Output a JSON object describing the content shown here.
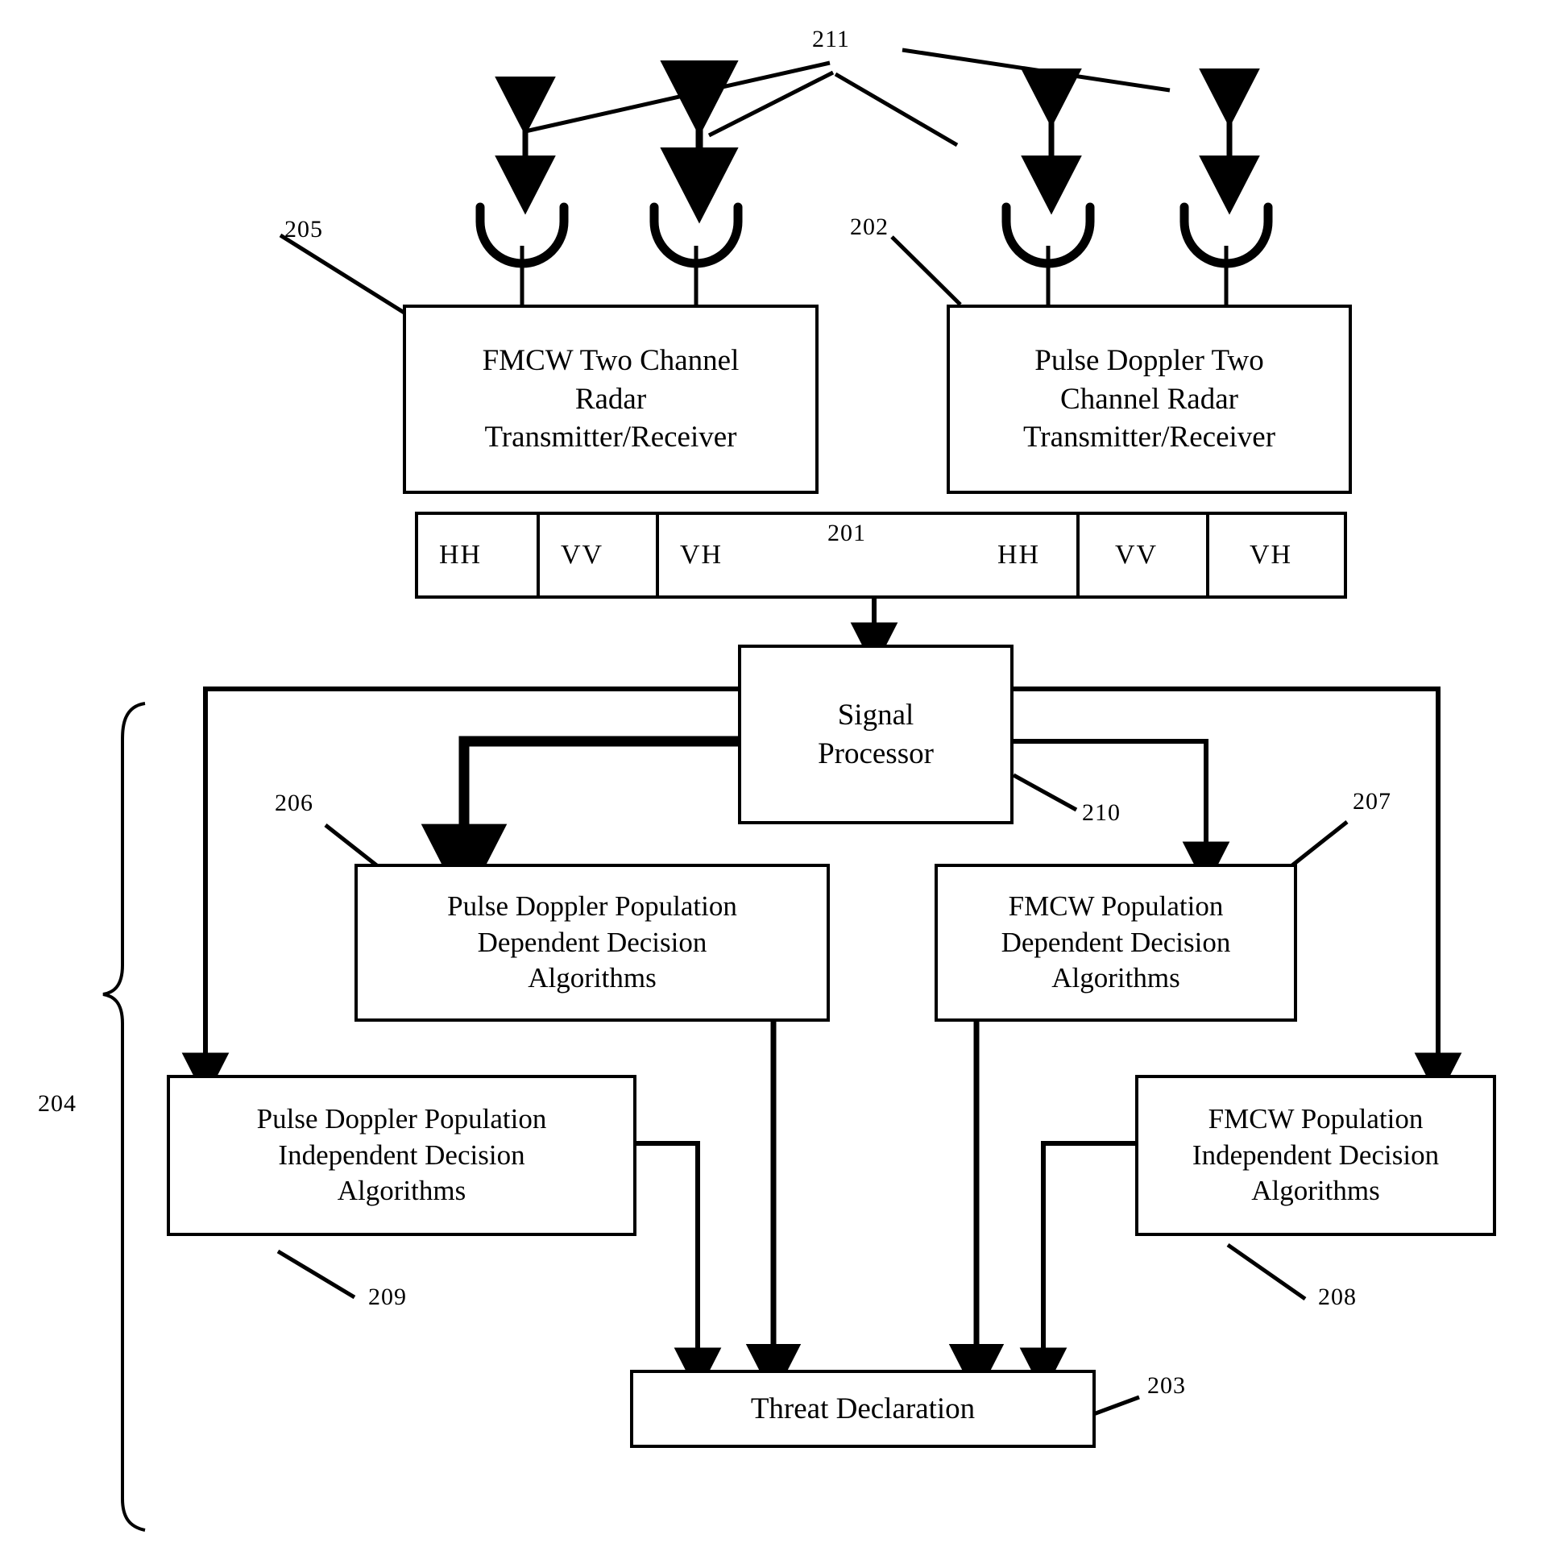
{
  "figure": {
    "type": "patent-block-diagram",
    "background": "#ffffff",
    "stroke": "#000000"
  },
  "blocks": {
    "fmcw_txrx": "FMCW Two Channel Radar Transmitter/Receiver",
    "fmcw_txrx_lines": [
      "FMCW Two Channel",
      "Radar",
      "Transmitter/Receiver"
    ],
    "pulse_txrx": "Pulse Doppler Two Channel Radar Transmitter/Receiver",
    "pulse_txrx_lines": [
      "Pulse Doppler Two",
      "Channel Radar",
      "Transmitter/Receiver"
    ],
    "signal_processor": "Signal Processor",
    "signal_processor_lines": [
      "Signal",
      "Processor"
    ],
    "pd_dependent_lines": [
      "Pulse Doppler Population",
      "Dependent Decision",
      "Algorithms"
    ],
    "fmcw_dependent_lines": [
      "FMCW Population",
      "Dependent Decision",
      "Algorithms"
    ],
    "pd_independent_lines": [
      "Pulse Doppler Population",
      "Independent Decision",
      "Algorithms"
    ],
    "fmcw_independent_lines": [
      "FMCW Population",
      "Independent Decision",
      "Algorithms"
    ],
    "threat_declaration": "Threat Declaration"
  },
  "polarization_cells": {
    "left": [
      "HH",
      "VV",
      "VH"
    ],
    "right": [
      "HH",
      "VV",
      "VH"
    ]
  },
  "reference_numerals": {
    "n201": "201",
    "n202": "202",
    "n203": "203",
    "n204": "204",
    "n205": "205",
    "n206": "206",
    "n207": "207",
    "n208": "208",
    "n209": "209",
    "n210": "210",
    "n211": "211"
  },
  "antennas": {
    "count": 4,
    "icon": "parabolic-dish-antenna-icon",
    "beam_icon": "bidirectional-arrow-icon"
  }
}
